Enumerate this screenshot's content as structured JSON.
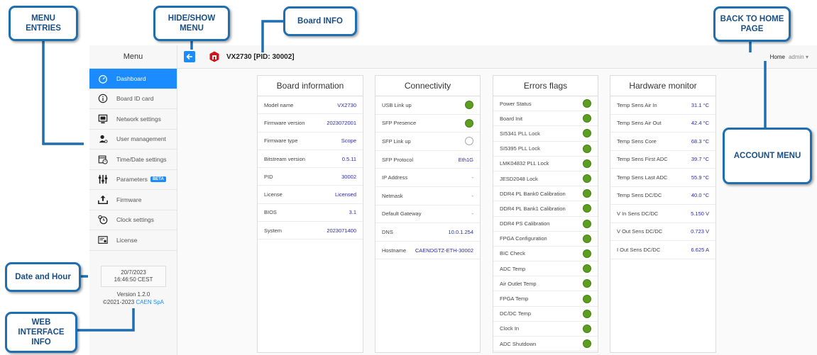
{
  "sidebar": {
    "header": "Menu",
    "items": [
      {
        "label": "Dashboard",
        "icon": "speedometer-icon",
        "active": true
      },
      {
        "label": "Board ID card",
        "icon": "info-icon"
      },
      {
        "label": "Network settings",
        "icon": "network-icon"
      },
      {
        "label": "User management",
        "icon": "user-icon"
      },
      {
        "label": "Time/Date settings",
        "icon": "calendar-clock-icon"
      },
      {
        "label": "Parameters",
        "icon": "sliders-icon",
        "badge": "BETA"
      },
      {
        "label": "Firmware",
        "icon": "upload-icon"
      },
      {
        "label": "Clock settings",
        "icon": "clock-icon"
      },
      {
        "label": "License",
        "icon": "license-icon"
      }
    ],
    "date": "20/7/2023",
    "time": "16:46:50 CEST",
    "version": "Version 1.2.0",
    "copyright_prefix": "©2021-2023",
    "company": "CAEN SpA"
  },
  "topbar": {
    "board_title": "VX2730 [PID: 30002]",
    "home_label": "Home",
    "user_label": "admin"
  },
  "cards": {
    "board_info": {
      "title": "Board information",
      "rows": [
        {
          "label": "Model name",
          "value": "VX2730"
        },
        {
          "label": "Firmware version",
          "value": "2023072001"
        },
        {
          "label": "Firmware type",
          "value": "Scope"
        },
        {
          "label": "Bitstream version",
          "value": "0.5.11"
        },
        {
          "label": "PID",
          "value": "30002"
        },
        {
          "label": "License",
          "value": "Licensed"
        },
        {
          "label": "BIOS",
          "value": "3.1"
        },
        {
          "label": "System",
          "value": "2023071400"
        }
      ]
    },
    "connectivity": {
      "title": "Connectivity",
      "rows": [
        {
          "label": "USB Link up",
          "status": "on"
        },
        {
          "label": "SFP Presence",
          "status": "on"
        },
        {
          "label": "SFP Link up",
          "status": "off"
        },
        {
          "label": "SFP Protocol",
          "value": "Eth1G"
        },
        {
          "label": "IP Address",
          "value": "-"
        },
        {
          "label": "Netmask",
          "value": "-"
        },
        {
          "label": "Default Gateway",
          "value": "-"
        },
        {
          "label": "DNS",
          "value": "10.0.1.254"
        },
        {
          "label": "Hostname",
          "value": "CAENDGTZ-ETH-30002"
        }
      ]
    },
    "errors": {
      "title": "Errors flags",
      "rows": [
        {
          "label": "Power Status"
        },
        {
          "label": "Board Init"
        },
        {
          "label": "SI5341 PLL Lock"
        },
        {
          "label": "SI5395 PLL Lock"
        },
        {
          "label": "LMK04832 PLL Lock"
        },
        {
          "label": "JESD2048 Lock"
        },
        {
          "label": "DDR4 PL Bank0 Calibration"
        },
        {
          "label": "DDR4 PL Bank1 Calibration"
        },
        {
          "label": "DDR4 PS Calibration"
        },
        {
          "label": "FPGA Configuration"
        },
        {
          "label": "BIC Check"
        },
        {
          "label": "ADC Temp"
        },
        {
          "label": "Air Outlet Temp"
        },
        {
          "label": "FPGA Temp"
        },
        {
          "label": "DC/DC Temp"
        },
        {
          "label": "Clock In"
        },
        {
          "label": "ADC Shutdown"
        }
      ]
    },
    "hardware": {
      "title": "Hardware monitor",
      "rows": [
        {
          "label": "Temp Sens Air In",
          "value": "31.1 °C"
        },
        {
          "label": "Temp Sens Air Out",
          "value": "42.4 °C"
        },
        {
          "label": "Temp Sens Core",
          "value": "68.3 °C"
        },
        {
          "label": "Temp Sens First ADC",
          "value": "39.7 °C"
        },
        {
          "label": "Temp Sens Last ADC",
          "value": "55.9 °C"
        },
        {
          "label": "Temp Sens DC/DC",
          "value": "40.0 °C"
        },
        {
          "label": "V In Sens DC/DC",
          "value": "5.150 V"
        },
        {
          "label": "V Out Sens DC/DC",
          "value": "0.723 V"
        },
        {
          "label": "I Out Sens DC/DC",
          "value": "6.625 A"
        }
      ]
    }
  },
  "callouts": {
    "menu_entries": "MENU ENTRIES",
    "hide_show": "HIDE/SHOW MENU",
    "board_info": "Board INFO",
    "back_home": "BACK TO HOME PAGE",
    "account_menu": "ACCOUNT MENU",
    "date_hour": "Date and Hour",
    "web_info": "WEB INTERFACE INFO"
  },
  "colors": {
    "accent": "#1a8cff",
    "status_on": "#5c9f20",
    "callout_border": "#1f6fb0",
    "value_text": "#2a2aa8"
  }
}
